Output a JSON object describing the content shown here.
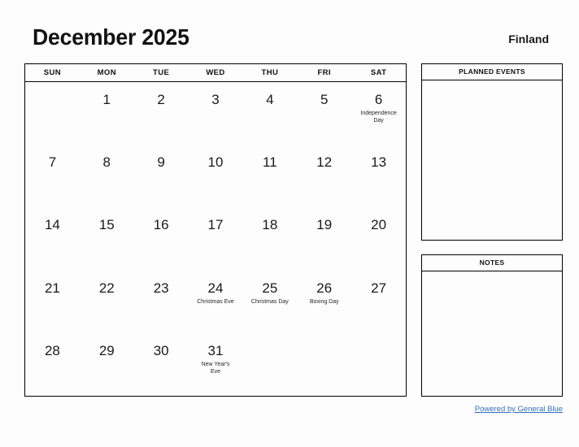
{
  "header": {
    "title": "December 2025",
    "region": "Finland"
  },
  "calendar": {
    "weekdays": [
      "SUN",
      "MON",
      "TUE",
      "WED",
      "THU",
      "FRI",
      "SAT"
    ],
    "weeks": [
      [
        {
          "day": "",
          "event": ""
        },
        {
          "day": "1",
          "event": ""
        },
        {
          "day": "2",
          "event": ""
        },
        {
          "day": "3",
          "event": ""
        },
        {
          "day": "4",
          "event": ""
        },
        {
          "day": "5",
          "event": ""
        },
        {
          "day": "6",
          "event": "Independence\nDay"
        }
      ],
      [
        {
          "day": "7",
          "event": ""
        },
        {
          "day": "8",
          "event": ""
        },
        {
          "day": "9",
          "event": ""
        },
        {
          "day": "10",
          "event": ""
        },
        {
          "day": "11",
          "event": ""
        },
        {
          "day": "12",
          "event": ""
        },
        {
          "day": "13",
          "event": ""
        }
      ],
      [
        {
          "day": "14",
          "event": ""
        },
        {
          "day": "15",
          "event": ""
        },
        {
          "day": "16",
          "event": ""
        },
        {
          "day": "17",
          "event": ""
        },
        {
          "day": "18",
          "event": ""
        },
        {
          "day": "19",
          "event": ""
        },
        {
          "day": "20",
          "event": ""
        }
      ],
      [
        {
          "day": "21",
          "event": ""
        },
        {
          "day": "22",
          "event": ""
        },
        {
          "day": "23",
          "event": ""
        },
        {
          "day": "24",
          "event": "Christmas Eve"
        },
        {
          "day": "25",
          "event": "Christmas Day"
        },
        {
          "day": "26",
          "event": "Boxing Day"
        },
        {
          "day": "27",
          "event": ""
        }
      ],
      [
        {
          "day": "28",
          "event": ""
        },
        {
          "day": "29",
          "event": ""
        },
        {
          "day": "30",
          "event": ""
        },
        {
          "day": "31",
          "event": "New Year's\nEve"
        },
        {
          "day": "",
          "event": ""
        },
        {
          "day": "",
          "event": ""
        },
        {
          "day": "",
          "event": ""
        }
      ]
    ]
  },
  "sidebar": {
    "planned_events_title": "PLANNED EVENTS",
    "planned_events_body": "",
    "notes_title": "NOTES",
    "notes_body": ""
  },
  "footer": {
    "link_text": "Powered by General Blue",
    "link_color": "#2f6fc0"
  }
}
